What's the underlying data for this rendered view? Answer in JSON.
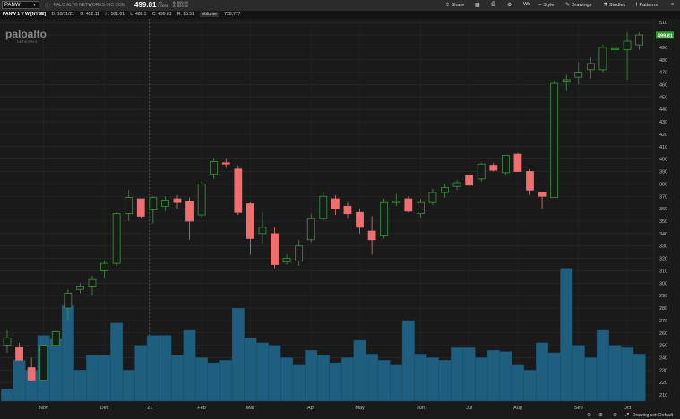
{
  "toolbar": {
    "symbol": "PANW",
    "company": "PALO ALTO NETWORKS INC COM",
    "last_price": "499.81",
    "change": "+0",
    "change_pct": "0.00%",
    "bid": "B: 500.00",
    "ask": "A: 503.52",
    "buttons": {
      "share": "Share",
      "timeframe": "Wk",
      "style": "Style",
      "drawings": "Drawings",
      "studies": "Studies",
      "patterns": "Patterns"
    }
  },
  "infobar": {
    "title": "PANW 1 Y W [NYSE]",
    "date": "D: 10/11/21",
    "open": "O: 492.11",
    "high": "H: 501.61",
    "low": "L: 488.1",
    "close": "C: 499.81",
    "range": "R: 13.51",
    "volume_label": "Volume",
    "volume_value": "728,777"
  },
  "logo": {
    "text": "paloalto",
    "sub": "NETWORKS"
  },
  "statusbar": {
    "drawing_set": "Drawing set: Default"
  },
  "chart_data": {
    "type": "candlestick",
    "symbol": "PANW",
    "interval": "weekly",
    "y_ticks": [
      210,
      220,
      230,
      240,
      250,
      260,
      270,
      280,
      290,
      300,
      310,
      320,
      330,
      340,
      350,
      360,
      370,
      380,
      390,
      400,
      410,
      420,
      430,
      440,
      450,
      460,
      470,
      480,
      490,
      500,
      510
    ],
    "ylim": [
      205,
      513
    ],
    "x_labels": [
      {
        "label": "Nov",
        "idx": 3
      },
      {
        "label": "Dec",
        "idx": 8
      },
      {
        "label": "'21",
        "idx": 11.7
      },
      {
        "label": "Feb",
        "idx": 16
      },
      {
        "label": "Mar",
        "idx": 20
      },
      {
        "label": "Apr",
        "idx": 25
      },
      {
        "label": "May",
        "idx": 29
      },
      {
        "label": "Jun",
        "idx": 34
      },
      {
        "label": "Jul",
        "idx": 38
      },
      {
        "label": "Aug",
        "idx": 42
      },
      {
        "label": "Sep",
        "idx": 47
      },
      {
        "label": "Oct",
        "idx": 51
      }
    ],
    "separators": [
      11.7
    ],
    "last_price_label": "499.81",
    "up_color": "#3a9a3a",
    "down_color": "#f26d6d",
    "volume_color": "#1e5f7f",
    "candles": [
      {
        "o": 250,
        "h": 262,
        "l": 244,
        "c": 256
      },
      {
        "o": 248,
        "h": 252,
        "l": 238,
        "c": 238
      },
      {
        "o": 232,
        "h": 240,
        "l": 222,
        "c": 222
      },
      {
        "o": 222,
        "h": 250,
        "l": 222,
        "c": 250
      },
      {
        "o": 250,
        "h": 262,
        "l": 248,
        "c": 261
      },
      {
        "o": 280,
        "h": 295,
        "l": 270,
        "c": 292
      },
      {
        "o": 295,
        "h": 300,
        "l": 292,
        "c": 297
      },
      {
        "o": 297,
        "h": 306,
        "l": 290,
        "c": 303
      },
      {
        "o": 310,
        "h": 318,
        "l": 304,
        "c": 316
      },
      {
        "o": 316,
        "h": 357,
        "l": 314,
        "c": 356
      },
      {
        "o": 356,
        "h": 375,
        "l": 350,
        "c": 369
      },
      {
        "o": 368,
        "h": 368,
        "l": 352,
        "c": 354
      },
      {
        "o": 359,
        "h": 370,
        "l": 348,
        "c": 369
      },
      {
        "o": 362,
        "h": 370,
        "l": 358,
        "c": 367
      },
      {
        "o": 368,
        "h": 371,
        "l": 360,
        "c": 365
      },
      {
        "o": 366,
        "h": 369,
        "l": 335,
        "c": 350
      },
      {
        "o": 355,
        "h": 382,
        "l": 352,
        "c": 380
      },
      {
        "o": 388,
        "h": 401,
        "l": 384,
        "c": 398
      },
      {
        "o": 397,
        "h": 400,
        "l": 393,
        "c": 396
      },
      {
        "o": 392,
        "h": 395,
        "l": 355,
        "c": 357
      },
      {
        "o": 364,
        "h": 365,
        "l": 323,
        "c": 336
      },
      {
        "o": 340,
        "h": 357,
        "l": 332,
        "c": 345
      },
      {
        "o": 340,
        "h": 345,
        "l": 312,
        "c": 315
      },
      {
        "o": 317,
        "h": 323,
        "l": 315,
        "c": 320
      },
      {
        "o": 318,
        "h": 335,
        "l": 314,
        "c": 330
      },
      {
        "o": 335,
        "h": 356,
        "l": 333,
        "c": 352
      },
      {
        "o": 352,
        "h": 374,
        "l": 350,
        "c": 370
      },
      {
        "o": 368,
        "h": 371,
        "l": 355,
        "c": 360
      },
      {
        "o": 362,
        "h": 365,
        "l": 352,
        "c": 356
      },
      {
        "o": 357,
        "h": 360,
        "l": 340,
        "c": 345
      },
      {
        "o": 342,
        "h": 354,
        "l": 323,
        "c": 335
      },
      {
        "o": 338,
        "h": 368,
        "l": 336,
        "c": 365
      },
      {
        "o": 365,
        "h": 372,
        "l": 362,
        "c": 366
      },
      {
        "o": 368,
        "h": 370,
        "l": 357,
        "c": 358
      },
      {
        "o": 356,
        "h": 368,
        "l": 353,
        "c": 365
      },
      {
        "o": 365,
        "h": 376,
        "l": 363,
        "c": 373
      },
      {
        "o": 373,
        "h": 380,
        "l": 369,
        "c": 377
      },
      {
        "o": 378,
        "h": 383,
        "l": 375,
        "c": 381
      },
      {
        "o": 387,
        "h": 389,
        "l": 378,
        "c": 379
      },
      {
        "o": 384,
        "h": 397,
        "l": 382,
        "c": 396
      },
      {
        "o": 395,
        "h": 397,
        "l": 390,
        "c": 391
      },
      {
        "o": 389,
        "h": 403,
        "l": 387,
        "c": 403
      },
      {
        "o": 404,
        "h": 405,
        "l": 390,
        "c": 390
      },
      {
        "o": 390,
        "h": 392,
        "l": 371,
        "c": 375
      },
      {
        "o": 373,
        "h": 372,
        "l": 360,
        "c": 370
      },
      {
        "o": 369,
        "h": 463,
        "l": 369,
        "c": 461
      },
      {
        "o": 462,
        "h": 468,
        "l": 455,
        "c": 464
      },
      {
        "o": 466,
        "h": 478,
        "l": 460,
        "c": 470
      },
      {
        "o": 472,
        "h": 482,
        "l": 465,
        "c": 477
      },
      {
        "o": 472,
        "h": 492,
        "l": 470,
        "c": 490
      },
      {
        "o": 488,
        "h": 491,
        "l": 485,
        "c": 489
      },
      {
        "o": 488,
        "h": 502,
        "l": 464,
        "c": 495
      },
      {
        "o": 492,
        "h": 502,
        "l": 488,
        "c": 500
      }
    ],
    "volume": [
      215,
      238,
      230,
      258,
      255,
      282,
      230,
      242,
      242,
      268,
      230,
      250,
      258,
      258,
      242,
      262,
      240,
      236,
      238,
      280,
      256,
      252,
      250,
      240,
      234,
      246,
      242,
      236,
      240,
      254,
      243,
      238,
      234,
      270,
      243,
      240,
      238,
      248,
      248,
      240,
      246,
      245,
      234,
      230,
      252,
      244,
      312,
      250,
      240,
      262,
      250,
      248,
      243
    ]
  }
}
